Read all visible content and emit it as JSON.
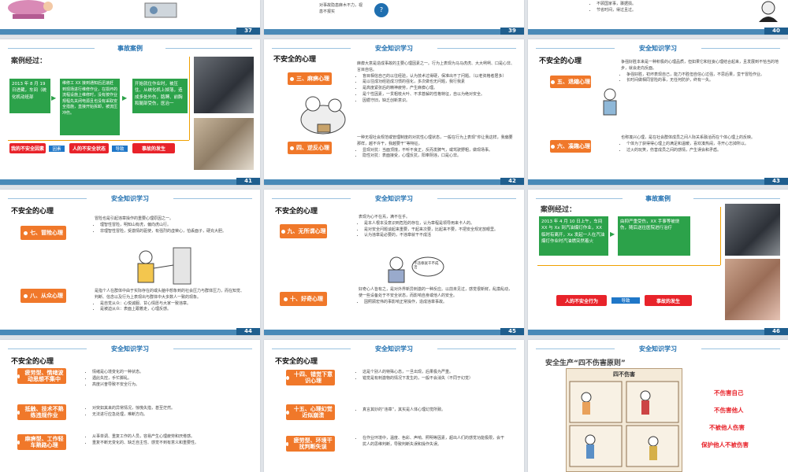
{
  "top_row": {
    "p37": "37",
    "p39": "39",
    "p40": "40",
    "s39_text_1": "对事故隐患麻木不力，视",
    "s39_text_2": "患不报实",
    "s40_text_1": "不顾国家事，骤据损。",
    "s40_text_2": "节省时间，得过且过。"
  },
  "s41": {
    "section": "事故案例",
    "heading": "案例经过：",
    "green1": "2013 年 8 月 19 日进藏，车间（统化机动班部",
    "green2": "维修工 XX 接到通知后迅速赶到现场进行维修作业，在损坏的流程设施上维修时，没有按作业规程先关闭电源且也没有采取安全措施，直接开始拆卸，被流压冲伤。",
    "green3": "开始就位作业时，被压住、从统化机上掉落，造成多处外伤，胳膊、前胸和腿部受伤，医治一",
    "red1": "我的不安全因素",
    "blue1": "因素",
    "red2": "人的不安全状态",
    "blue2": "导致",
    "red3": "事故的发生",
    "page": "41"
  },
  "s42": {
    "section": "安全知识学习",
    "heading": "不安全的心理",
    "label1": "三、麻痹心理",
    "label2": "四、逆反心理",
    "para1": "麻痹大意是造成事故的主要心理因素之一。行为上表现为马马虎虎、大大咧咧、口是心非、言目自信。",
    "bullets1": [
      "盲目相信自己的以往经验，认为技术过得硬，保准出不了问题。（以老资格者居多）",
      "是以往成功经验成习惯的强化，多次做也无问题，我行我素",
      "是高度紧张后的精神疲劳，产生麻痹心理。",
      "是个性因素，一贯粗枝大叶、不求甚解的性格特征，自以为绝对安全。",
      "因循守旧，缺乏创新意识。"
    ],
    "para2": "一种无视社会规范或管理制度的对抗性心理状态，一般在行为上表现“你让我这样，我偏要那样，越不许干，我越要干”等特征。",
    "bullets2": [
      "显现对抗：当面顶撞，不听不良正，反而发脾气，或驾驶野粗，做现场事。",
      "隐性对抗：表面接受，心理反抗，阳奉阴违，口是心非。"
    ],
    "page": "42"
  },
  "s43": {
    "section": "安全知识学习",
    "heading": "不安全的心理",
    "label1": "五、退縮心理",
    "label2": "六、凑趣心理",
    "para1": "争强好胜本来是一种积极的心理品质，但如果它和狂妄心理结合起来，且发展到不恰当的地步，就会走向反面。",
    "bullets1": [
      "争强好胜，初坏表现自己，能力不胜但自信心过强，不思后果，蛮干冒险作业。",
      "长时间做相同冒险的事，无任何防护，终有一失。"
    ],
    "para2": "也称凑兴心理，是在社会群体成员之间人际关系融洽而在个体心理上的反映。",
    "bullets2": [
      "个体为了获得得心理上的满足和温暖，喜欢凑热闹，寻开心忘掉所以。",
      "过火的玩笑，伤害成员之间的感情，产生误会和矛盾。"
    ],
    "page": "43"
  },
  "s44": {
    "section": "安全知识学习",
    "heading": "不安全的心理",
    "label1": "七、冒险心理",
    "label2": "八、从众心理",
    "para1": "冒险也是引起违章操作的重要心理原因之一。",
    "bullets1": [
      "理智性冒险，明知山有虎，偏向虎山行。",
      "非理智性冒险，受激情的驱使，有强烈的虚荣心，怕丢面子，硬充大胆。"
    ],
    "para2": "是指个人在群体中由于实际存在的或头脑中想象到的社会压力与群体压力，而在知觉、判断、信念以及行为上表现出与群体中大多数人一致的现象。",
    "bullets2": [
      "是自觉从众：心悦诚服、甘心情愿与大家一致违章。",
      "是被迫从众：表面上跟着走，心理反感。"
    ],
    "page": "44"
  },
  "s45": {
    "section": "安全知识学习",
    "heading": "不安全的心理",
    "label1": "九、无所谓心理",
    "label2": "十、好奇心理",
    "para1": "表现为心不在焉，满不在乎。",
    "bullets1": [
      "是本人根本没意识到危险的存在，认为章程是领导用来卡人的。",
      "是对安全问题谈起来重要，干起来次要，比起来不要，不把安全规定放眼里。",
      "认为违章是必要的，不违章就干不成活"
    ],
    "bubble": "不违章就干不成活",
    "para2": "好奇心人皆有之，是对外界新异刺激的一种反应。以前未见过，感觉很新鲜，乱摸乱动，使一些设备处于不安全状态，而影响自身或他人的安全。",
    "bullets2": [
      "因照顾宏伟的事影响正常操作，造成违章事故。"
    ],
    "page": "45"
  },
  "s46": {
    "section": "事故案例",
    "heading": "案例经过：",
    "green1": "2013 年 4 月 10 日上午，车间 XX 与 Xx 到汽油爆灯作业，XX 临时有离开，Xx 发起一人在汽油爆灯作业时汽油燃突然着火",
    "green2": "由抑严重受伤，XX 手事等被烧伤，随后送往医院进行治疗",
    "red1": "人的不安全行为",
    "blue1": "导致",
    "red2": "事故的发生",
    "page": "46"
  },
  "s47": {
    "section": "安全知识学习",
    "heading": "不安全的心理",
    "label1": "疲劳型、情绪波动思想不集中",
    "label2": "抵触、技术不熟练违规作业",
    "label3": "麻痹型、工作轻车熟路心理",
    "bullets1": [
      "情绪是心境变化的一种状态。",
      "遇此失控，手忙脚乱。",
      "高度兴奋导致不安全行为。"
    ],
    "bullets2": [
      "对突如其来的异常情况，惊慌失措，甚至茫然。",
      "无法进行应急处理，难断方向。"
    ],
    "bullets3": [
      "从事单调、重复工作的人员，容易产生心理疲劳和厌倦感。",
      "重复不断无变化的、缺乏自主性、感觉不到有意义和重要性。"
    ]
  },
  "s48": {
    "section": "安全知识学习",
    "heading": "不安全的心理",
    "label1": "十四、错觉下意识心理",
    "label2": "十五、心理幻觉近似崩溃",
    "label3": "疲劳型、环境干扰判断失误",
    "bullets1": [
      "这是个别人的特殊心态，一旦出现，后果极为严重。",
      "错觉是有刺激物的情况下发生的，一般不会消失（不同于幻觉）"
    ],
    "bullets2": [
      "真言其妙的“违章”，其实是人体心理幻觉所致。"
    ],
    "bullets3": [
      "在作业环境中，温度、色彩、声响、照明等因素，超出人们的感觉功能极限，会干扰人的思维判断，导致判断失误和操作失误。"
    ]
  },
  "s49": {
    "section": "安全知识学习",
    "heading": "安全生产“四不伤害原则”",
    "poster_title": "四不伤害",
    "items": [
      "不伤害自己",
      "不伤害他人",
      "不被他人伤害",
      "保护他人不被伤害"
    ]
  }
}
